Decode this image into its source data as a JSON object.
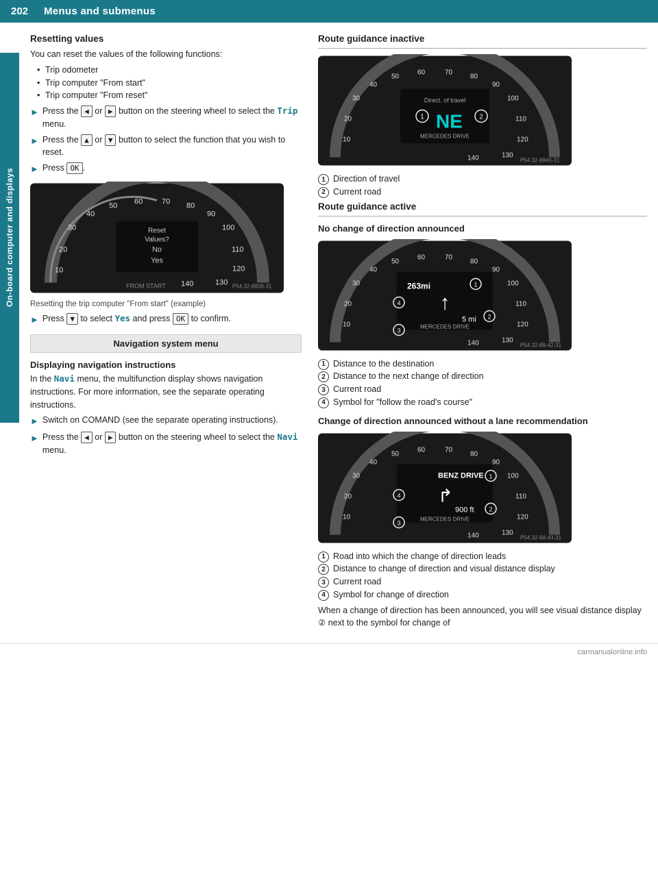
{
  "header": {
    "page_number": "202",
    "title": "Menus and submenus"
  },
  "side_tab": {
    "label": "On-board computer and displays"
  },
  "left_col": {
    "resetting_values": {
      "heading": "Resetting values",
      "intro": "You can reset the values of the following functions:",
      "bullets": [
        "Trip odometer",
        "Trip computer \"From start\"",
        "Trip computer \"From reset\""
      ],
      "instructions": [
        {
          "text_before": "Press the",
          "key1": "◄",
          "text_mid": "or",
          "key2": "►",
          "text_after": "button on the steering wheel to select the",
          "code": "Trip",
          "text_end": "menu."
        },
        {
          "text_before": "Press the",
          "key1": "▲",
          "text_mid": "or",
          "key2": "▼",
          "text_after": "button to select the function that you wish to reset."
        },
        {
          "text_before": "Press",
          "key1": "OK",
          "text_after": "."
        }
      ],
      "img_caption": "Resetting the trip computer \"From start\" (example)",
      "confirm_instruction": {
        "text_before": "Press",
        "key1": "▼",
        "text_mid": "to select",
        "code": "Yes",
        "text_after": "and press",
        "key2": "OK",
        "text_end": "to confirm."
      }
    },
    "nav_menu": {
      "label": "Navigation system menu"
    },
    "displaying_nav": {
      "heading": "Displaying navigation instructions",
      "intro_1": "In the",
      "code": "Navi",
      "intro_2": "menu, the multifunction display shows navigation instructions. For more information, see the separate operating instructions.",
      "instructions": [
        {
          "text": "Switch on COMAND (see the separate operating instructions)."
        },
        {
          "text_before": "Press the",
          "key1": "◄",
          "text_mid": "or",
          "key2": "►",
          "text_after": "button on the steering wheel to select the",
          "code": "Navi",
          "text_end": "menu."
        }
      ]
    }
  },
  "right_col": {
    "route_inactive": {
      "heading": "Route guidance inactive",
      "numbered_items": [
        "Direction of travel",
        "Current road"
      ]
    },
    "route_active": {
      "heading": "Route guidance active"
    },
    "no_change": {
      "heading": "No change of direction announced",
      "numbered_items": [
        "Distance to the destination",
        "Distance to the next change of direction",
        "Current road",
        "Symbol for \"follow the road's course\""
      ]
    },
    "change_without": {
      "heading": "Change of direction announced without a lane recommendation",
      "numbered_items": [
        "Road into which the change of direction leads",
        "Distance to change of direction and visual distance display",
        "Current road",
        "Symbol for change of direction"
      ],
      "trailing_text": "When a change of direction has been announced, you will see visual distance display ② next to the symbol for change of"
    }
  },
  "watermark": {
    "text": "carmanualonline.info"
  }
}
